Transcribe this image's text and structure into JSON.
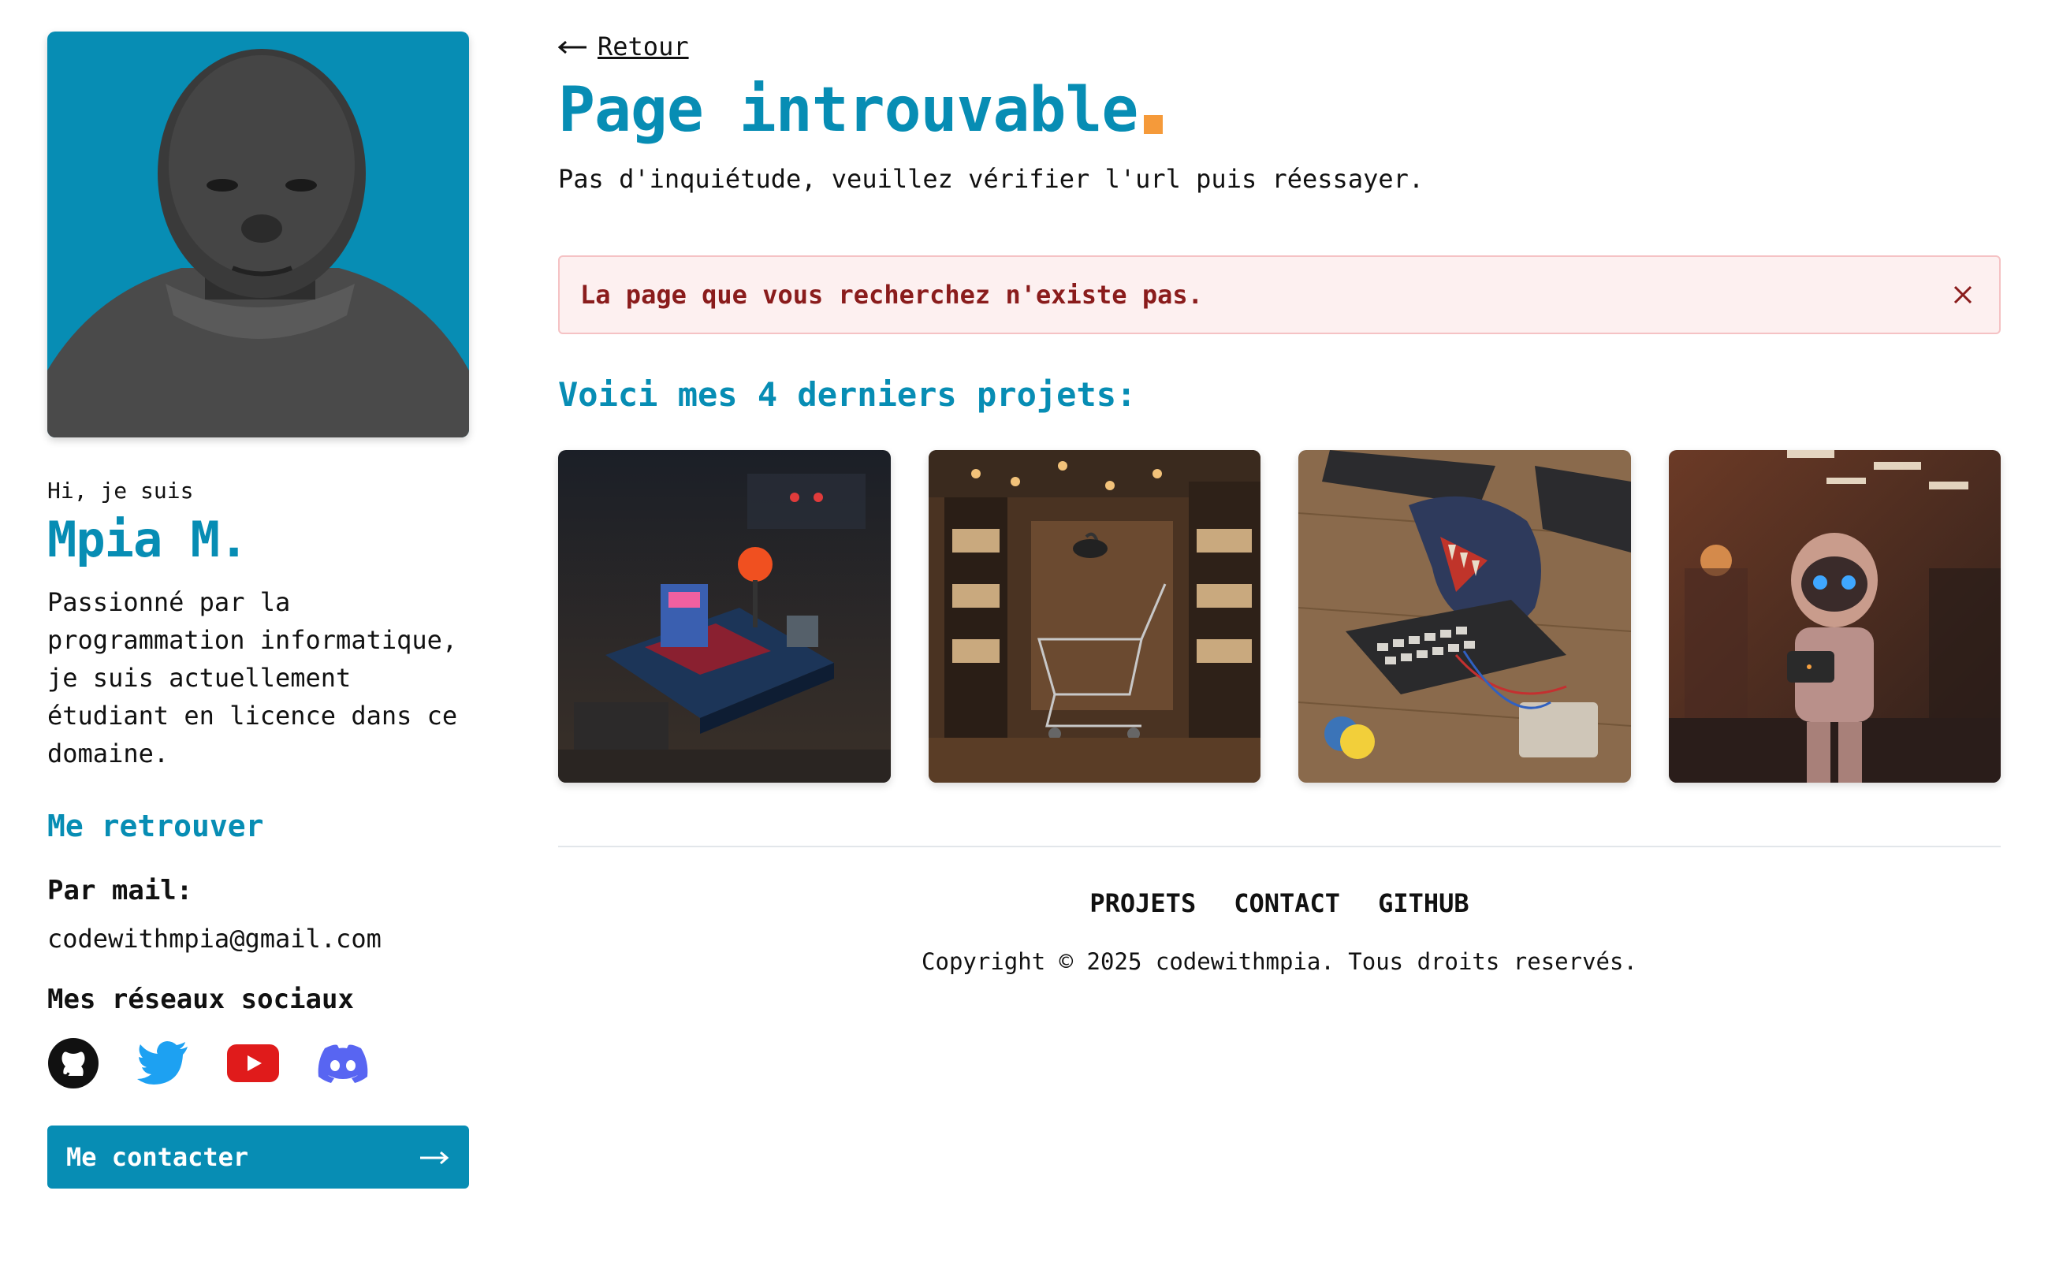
{
  "profile": {
    "greeting": "Hi, je suis",
    "name": "Mpia M.",
    "bio": "Passionné par la programmation informatique, je suis actuellement étudiant en licence dans ce domaine.",
    "find_me_heading": "Me retrouver",
    "mail_label": "Par mail:",
    "mail_value": "codewithmpia@gmail.com",
    "social_label": "Mes réseaux sociaux",
    "socials": [
      "github-icon",
      "twitter-icon",
      "youtube-icon",
      "discord-icon"
    ],
    "contact_button": "Me contacter"
  },
  "main": {
    "back_label": "Retour",
    "title": "Page introuvable",
    "subtitle": "Pas d'inquiétude, veuillez vérifier l'url puis réessayer.",
    "alert_text": "La page que vous recherchez n'existe pas.",
    "projects_heading": "Voici mes 4 derniers projets:"
  },
  "footer": {
    "nav": [
      "PROJETS",
      "CONTACT",
      "GITHUB"
    ],
    "copyright": "Copyright © 2025 codewithmpia. Tous droits reservés."
  },
  "colors": {
    "accent": "#078db4",
    "title_dot": "#f59a3a",
    "alert_bg": "#fdf0f0",
    "alert_border": "#f5c2c4",
    "alert_text": "#8a1c1c"
  }
}
